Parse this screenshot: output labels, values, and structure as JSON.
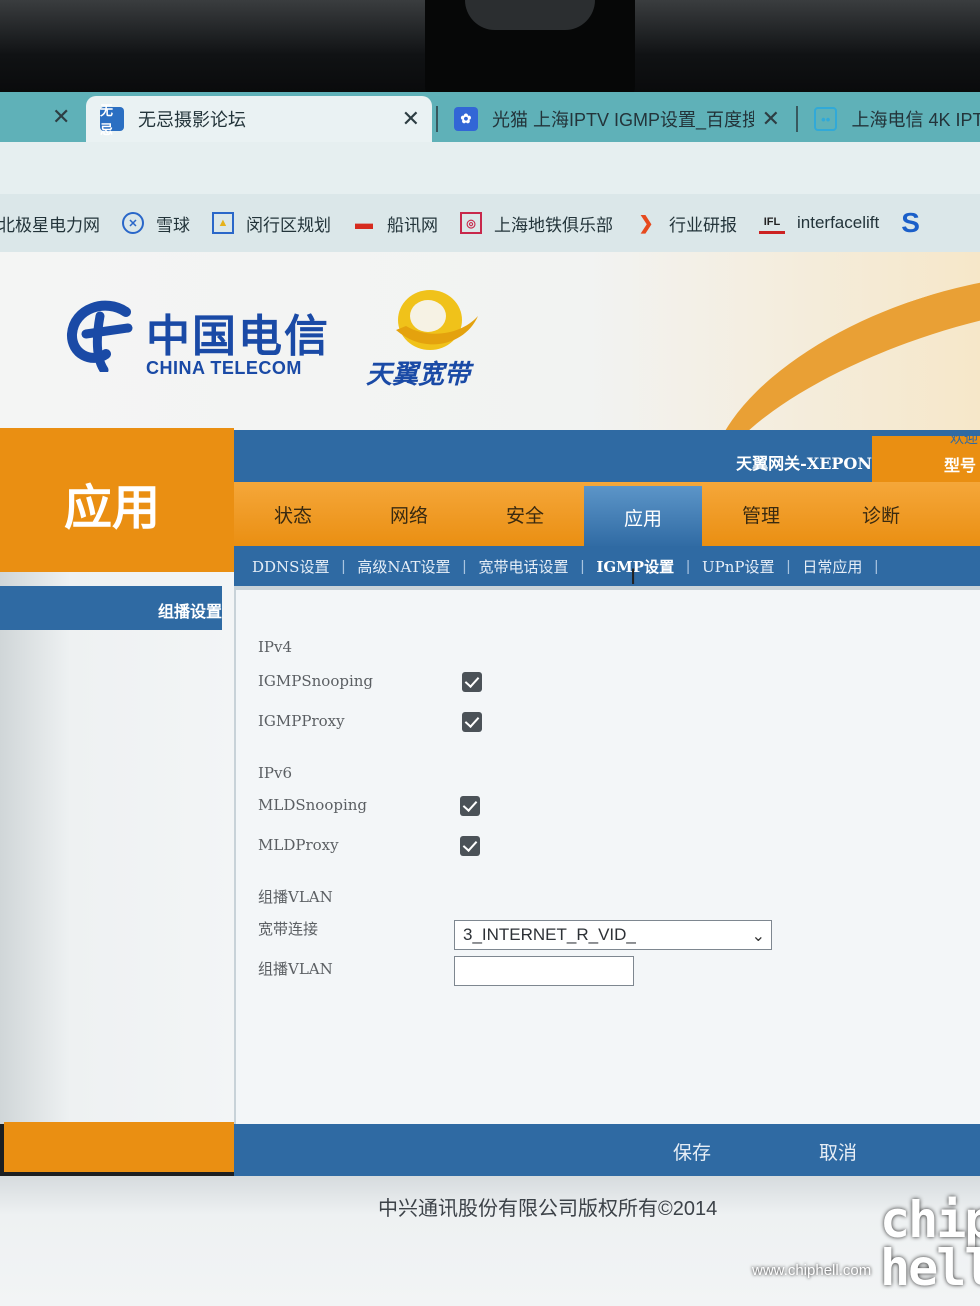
{
  "browser": {
    "tabs": [
      {
        "label": "无忌摄影论坛",
        "favicon": "wuji-icon",
        "active": true
      },
      {
        "label": "光猫 上海IPTV IGMP设置_百度搜",
        "favicon": "baidu-paw-icon",
        "active": false
      },
      {
        "label": "上海电信 4K IPT",
        "favicon": "bilibili-tv-icon",
        "active": false
      }
    ],
    "bookmarks": [
      {
        "label": "北极星电力网",
        "icon": ""
      },
      {
        "label": "雪球",
        "icon": "snowball-icon"
      },
      {
        "label": "闵行区规划",
        "icon": "planning-icon"
      },
      {
        "label": "船讯网",
        "icon": "ship-icon"
      },
      {
        "label": "上海地铁俱乐部",
        "icon": "metro-icon"
      },
      {
        "label": "行业研报",
        "icon": "report-icon"
      },
      {
        "label": "interfacelift",
        "icon": "IFL"
      }
    ],
    "favicon_wuji_text": "无忌",
    "bookmark_ifl_text": "IFL",
    "bookmark_overflow_text": "S"
  },
  "header": {
    "brand_cn": "中国电信",
    "brand_en": "CHINA TELECOM",
    "product": "天翼宽带",
    "welcome": "欢迎",
    "gateway": "天翼网关-XEPON",
    "model_label": "型号"
  },
  "section_title": "应用",
  "nav": {
    "tabs": [
      "状态",
      "网络",
      "安全",
      "应用",
      "管理",
      "诊断"
    ],
    "active_index": 3
  },
  "subnav": {
    "items": [
      "DDNS设置",
      "高级NAT设置",
      "宽带电话设置",
      "IGMP设置",
      "UPnP设置",
      "日常应用"
    ],
    "active_index": 3
  },
  "sidebar": {
    "items": [
      {
        "label": "组播设置"
      }
    ]
  },
  "form": {
    "ipv4_label": "IPv4",
    "igmp_snooping_label": "IGMPSnooping",
    "igmp_snooping_checked": true,
    "igmp_proxy_label": "IGMPProxy",
    "igmp_proxy_checked": true,
    "ipv6_label": "IPv6",
    "mld_snooping_label": "MLDSnooping",
    "mld_snooping_checked": true,
    "mld_proxy_label": "MLDProxy",
    "mld_proxy_checked": true,
    "multicast_vlan_section": "组播VLAN",
    "broadband_label": "宽带连接",
    "broadband_value": "3_INTERNET_R_VID_",
    "multicast_vlan_label": "组播VLAN",
    "multicast_vlan_value": ""
  },
  "buttons": {
    "save": "保存",
    "cancel": "取消"
  },
  "footer": {
    "copyright": "中兴通讯股份有限公司版权所有©2014"
  },
  "watermark": {
    "url": "www.chiphell.com",
    "logo": "chip hell"
  },
  "colors": {
    "telecom_blue": "#2f6aa3",
    "telecom_orange": "#ea8f12",
    "brand_blue": "#1a4aa6"
  }
}
